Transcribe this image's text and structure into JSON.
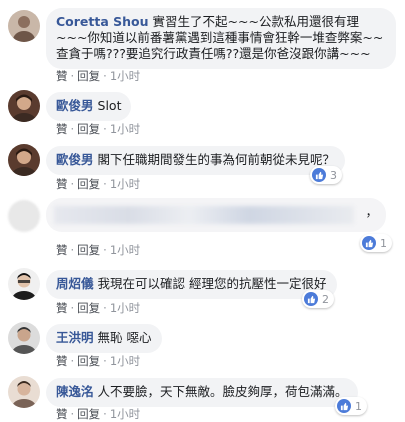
{
  "comments": [
    {
      "author": "Coretta Shou",
      "text": "實習生了不起~~~公款私用還很有理~~~你知道以前番薯黨遇到這種事情會狂幹一堆查弊案~~查貪于嗎???要追究行政責任嗎??還是你爸沒跟你講~~~",
      "like": "贊",
      "reply": "回复",
      "time": "1小时",
      "avatar_color": "#c9b7a8"
    },
    {
      "author": "歐俊男",
      "text": "Slot",
      "like": "贊",
      "reply": "回复",
      "time": "1小时",
      "avatar_color": "#5a3b2e"
    },
    {
      "author": "歐俊男",
      "text": "閣下任職期間發生的事為何前朝從未見呢？",
      "like": "贊",
      "reply": "回复",
      "time": "1小时",
      "reactions": "3",
      "avatar_color": "#5a3b2e"
    },
    {
      "author": "",
      "text": "，",
      "like": "贊",
      "reply": "回复",
      "time": "1小时",
      "reactions": "1",
      "blurred": true,
      "avatar_color": "#e8e8e8"
    },
    {
      "author": "周炤儀",
      "text": "我現在可以確認 經理您的抗壓性一定很好",
      "like": "贊",
      "reply": "回复",
      "time": "1小时",
      "reactions": "2",
      "avatar_color": "#2f2f2f"
    },
    {
      "author": "王洪明",
      "text": "無恥 噁心",
      "like": "贊",
      "reply": "回复",
      "time": "1小时",
      "avatar_color": "#6f6f6f"
    },
    {
      "author": "陳逸洺",
      "text": "人不要臉，天下無敵。臉皮夠厚，荷包滿滿。",
      "like": "贊",
      "reply": "回复",
      "time": "1小时",
      "reactions": "1",
      "avatar_color": "#b89a86"
    }
  ],
  "colors": {
    "author": "#385898",
    "bubble": "#f2f3f5",
    "meta": "#90949c",
    "like_badge": "#4c7bd9"
  },
  "icons": {
    "reaction": "thumbs-up-icon"
  }
}
